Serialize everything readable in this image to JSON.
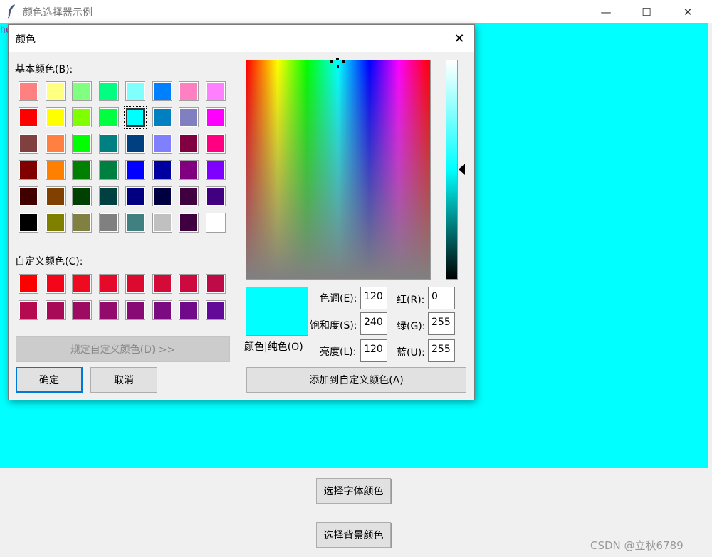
{
  "window": {
    "title": "颜色选择器示例",
    "minimize": "—",
    "maximize": "☐",
    "close": "✕",
    "canvas_text": "he",
    "canvas_color": "#00ffff"
  },
  "buttons": {
    "font_color": "选择字体颜色",
    "bg_color": "选择背景颜色"
  },
  "watermark": "CSDN @立秋6789",
  "dialog": {
    "title": "颜色",
    "close": "✕",
    "basic_label": "基本颜色(B):",
    "custom_label": "自定义颜色(C):",
    "basic_colors": [
      [
        "#ff8080",
        "#ffff80",
        "#80ff80",
        "#00ff80",
        "#80ffff",
        "#0080ff",
        "#ff80c0",
        "#ff80ff"
      ],
      [
        "#ff0000",
        "#ffff00",
        "#80ff00",
        "#00ff40",
        "#00ffff",
        "#0080c0",
        "#8080c0",
        "#ff00ff"
      ],
      [
        "#804040",
        "#ff8040",
        "#00ff00",
        "#008080",
        "#004080",
        "#8080ff",
        "#800040",
        "#ff0080"
      ],
      [
        "#800000",
        "#ff8000",
        "#008000",
        "#008040",
        "#0000ff",
        "#0000a0",
        "#800080",
        "#8000ff"
      ],
      [
        "#400000",
        "#804000",
        "#004000",
        "#004040",
        "#000080",
        "#000040",
        "#400040",
        "#400080"
      ],
      [
        "#000000",
        "#808000",
        "#808040",
        "#808080",
        "#408080",
        "#c0c0c0",
        "#400040",
        "#ffffff"
      ]
    ],
    "selected_basic": [
      1,
      4
    ],
    "custom_colors": [
      [
        "#ff0000",
        "#f50519",
        "#ef0a20",
        "#e50a2a",
        "#dd0a30",
        "#d40a38",
        "#cc0a40",
        "#bf0a48"
      ],
      [
        "#b50a50",
        "#a80a58",
        "#9c0a62",
        "#920a6c",
        "#880a74",
        "#7c0a80",
        "#700a8a",
        "#640a98"
      ]
    ],
    "preview_label": "颜色|纯色(O)",
    "fields": {
      "hue_label": "色调(E):",
      "hue": "120",
      "sat_label": "饱和度(S):",
      "sat": "240",
      "lum_label": "亮度(L):",
      "lum": "120",
      "red_label": "红(R):",
      "red": "0",
      "green_label": "绿(G):",
      "green": "255",
      "blue_label": "蓝(U):",
      "blue": "255"
    },
    "define_custom": "规定自定义颜色(D) >>",
    "ok": "确定",
    "cancel": "取消",
    "add_custom": "添加到自定义颜色(A)"
  }
}
